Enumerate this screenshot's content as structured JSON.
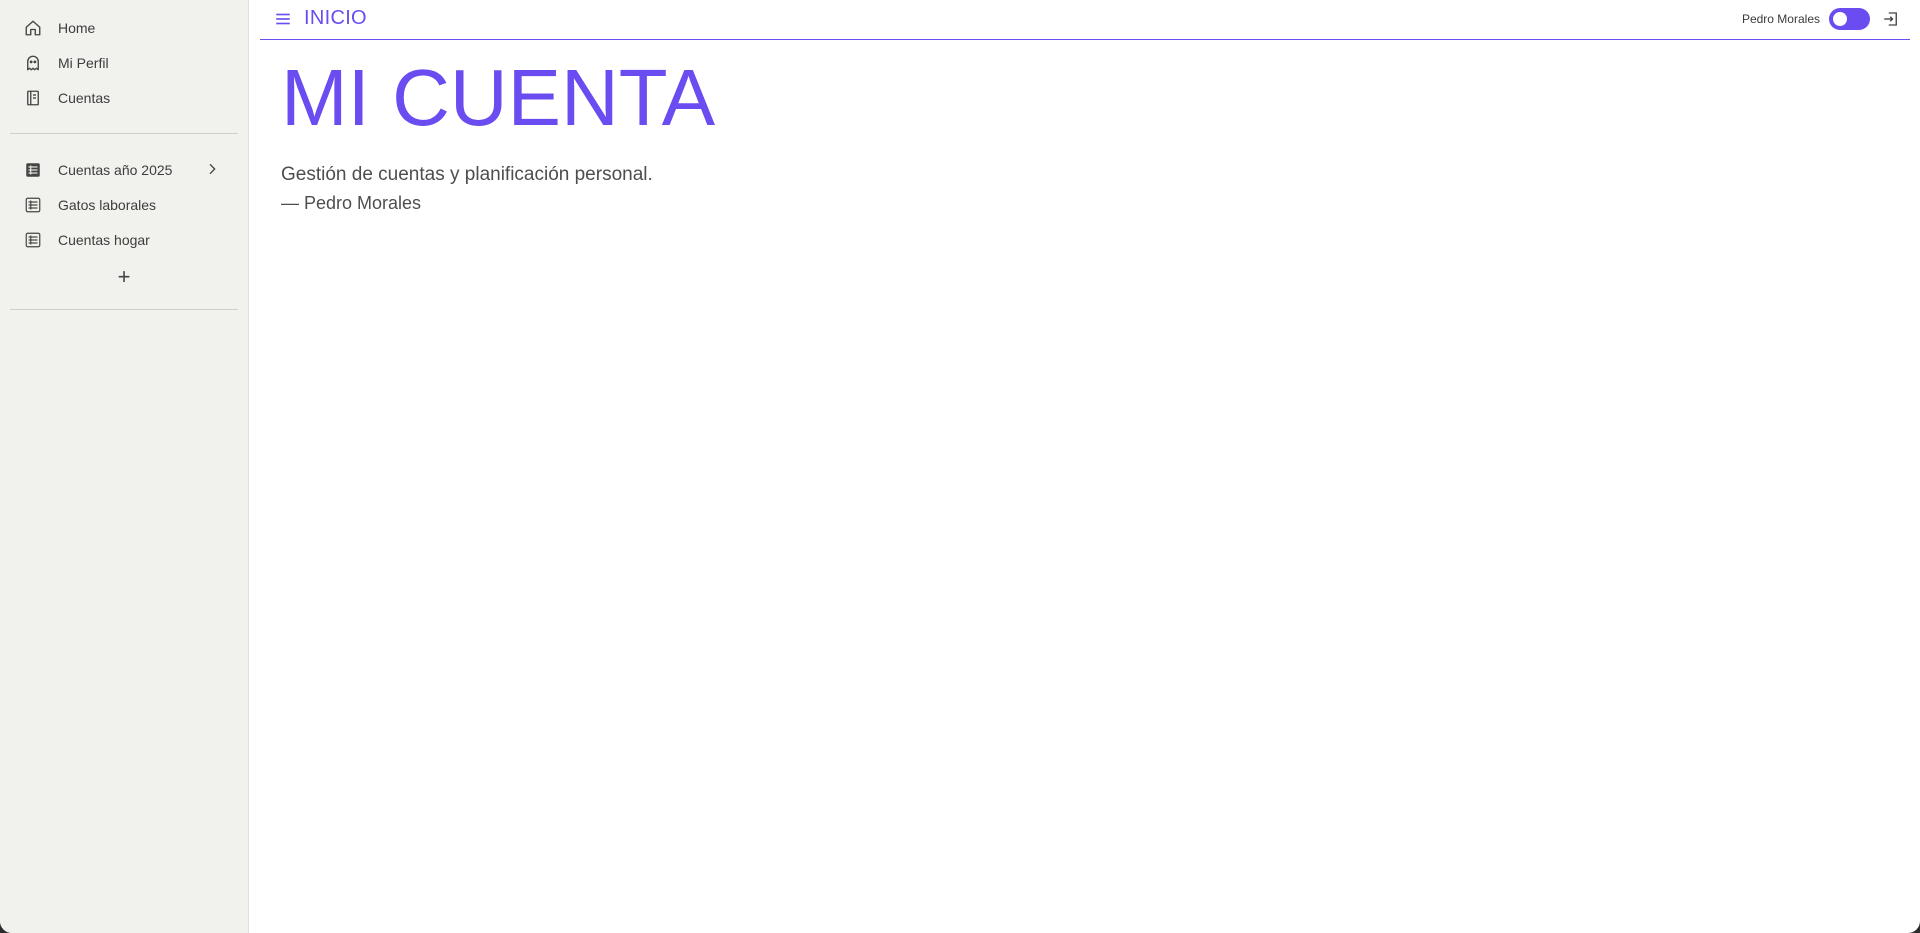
{
  "sidebar": {
    "main_items": [
      {
        "label": "Home",
        "icon": "home-icon"
      },
      {
        "label": "Mi Perfil",
        "icon": "ghost-icon"
      },
      {
        "label": "Cuentas",
        "icon": "notebook-icon"
      }
    ],
    "account_items": [
      {
        "label": "Cuentas año 2025",
        "icon": "table-filled-icon",
        "has_submenu": true
      },
      {
        "label": "Gatos laborales",
        "icon": "table-icon"
      },
      {
        "label": "Cuentas hogar",
        "icon": "table-icon"
      }
    ],
    "add_label": "+"
  },
  "topbar": {
    "title": "INICIO",
    "user_name": "Pedro Morales",
    "theme_toggle": "on"
  },
  "main": {
    "title": "MI CUENTA",
    "quote": "Gestión de cuentas y planificación personal.",
    "author": "— Pedro Morales"
  },
  "colors": {
    "accent": "#6a4cf0",
    "sidebar_bg": "#f1f1ed",
    "text": "#4e4e4e"
  }
}
